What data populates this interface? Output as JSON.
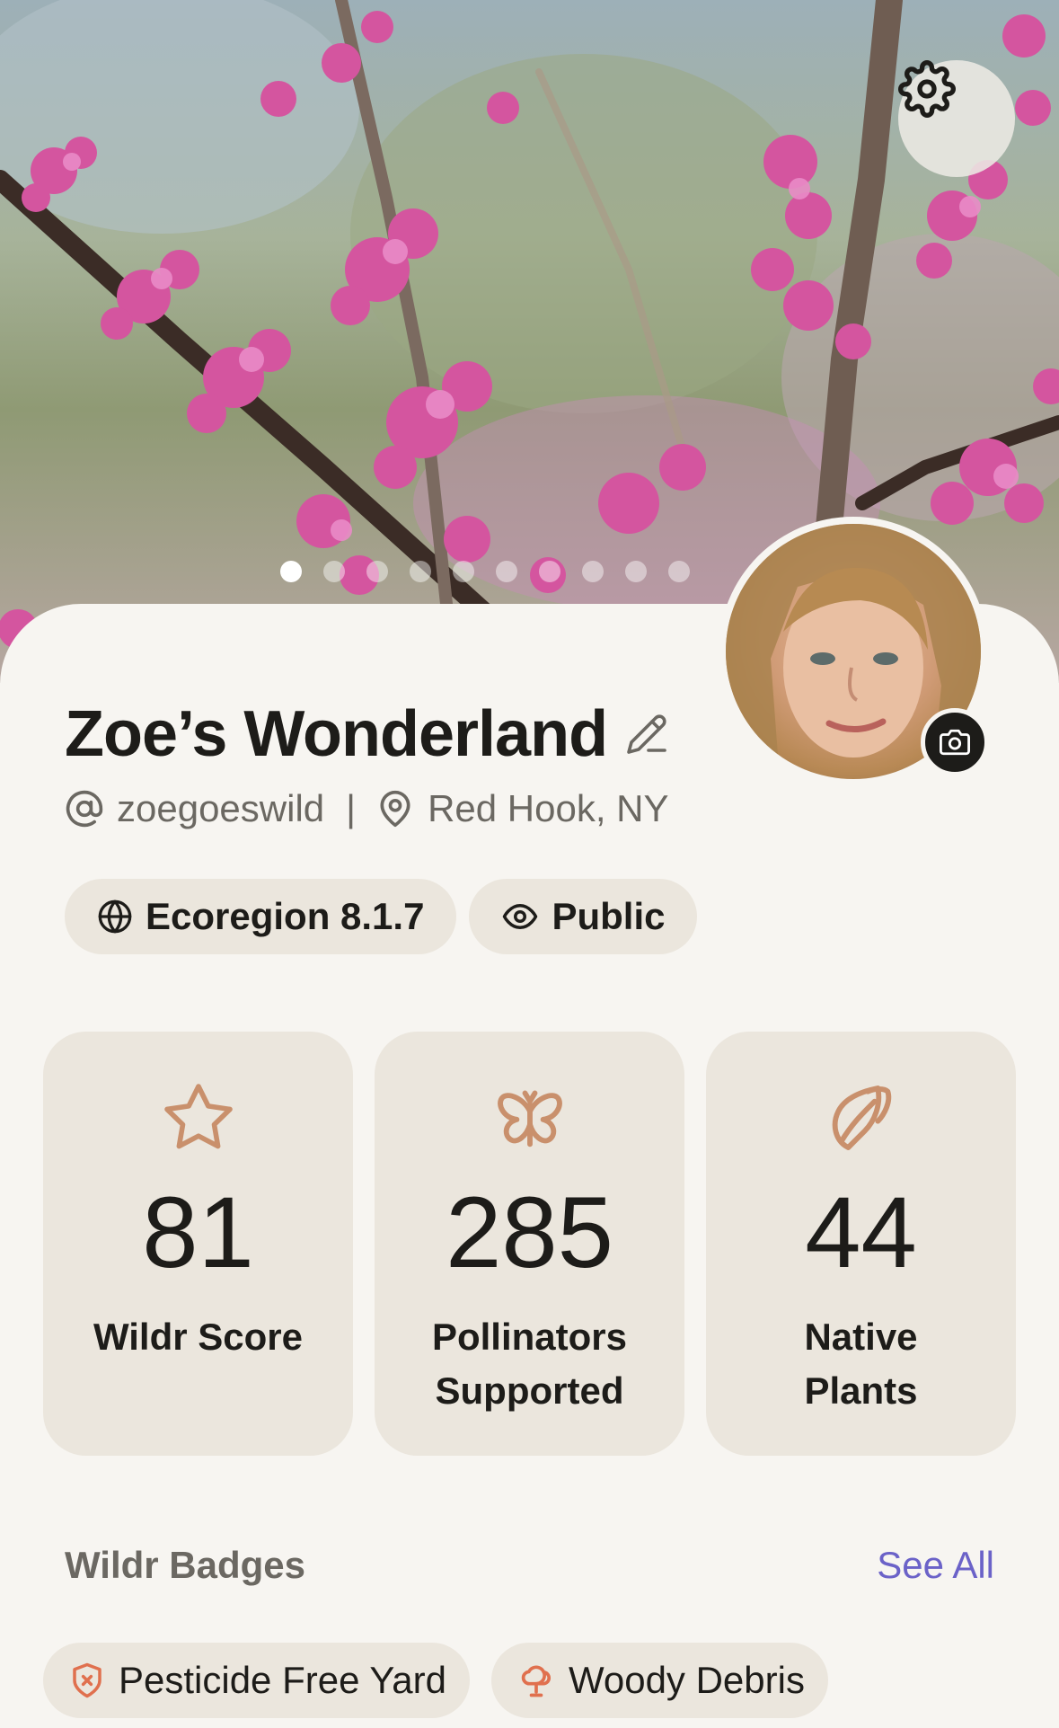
{
  "hero": {
    "settings_icon": "gear-icon",
    "carousel_pages": 11,
    "carousel_active_index": 0
  },
  "profile": {
    "name": "Zoe’s Wonderland",
    "edit_icon": "pencil-icon",
    "username": "zoegoeswild",
    "separator": "|",
    "location": "Red Hook, NY",
    "camera_icon": "camera-icon"
  },
  "chips": [
    {
      "icon": "globe-icon",
      "label": "Ecoregion 8.1.7"
    },
    {
      "icon": "eye-icon",
      "label": "Public"
    }
  ],
  "stats": [
    {
      "icon": "star-icon",
      "value": "81",
      "label": "Wildr Score"
    },
    {
      "icon": "butterfly-icon",
      "value": "285",
      "label": "Pollinators Supported"
    },
    {
      "icon": "leaf-icon",
      "value": "44",
      "label": "Native Plants"
    }
  ],
  "badges": {
    "title": "Wildr Badges",
    "see_all": "See All",
    "items": [
      {
        "icon": "shield-icon",
        "label": "Pesticide Free Yard"
      },
      {
        "icon": "tree-icon",
        "label": "Woody Debris"
      }
    ]
  },
  "colors": {
    "background": "#f7f5f1",
    "card": "#ebe6dd",
    "accent_icon": "#c9906c",
    "badge_icon": "#e0704e",
    "link": "#6b62c8",
    "text": "#1d1c19",
    "muted": "#6b6862"
  }
}
